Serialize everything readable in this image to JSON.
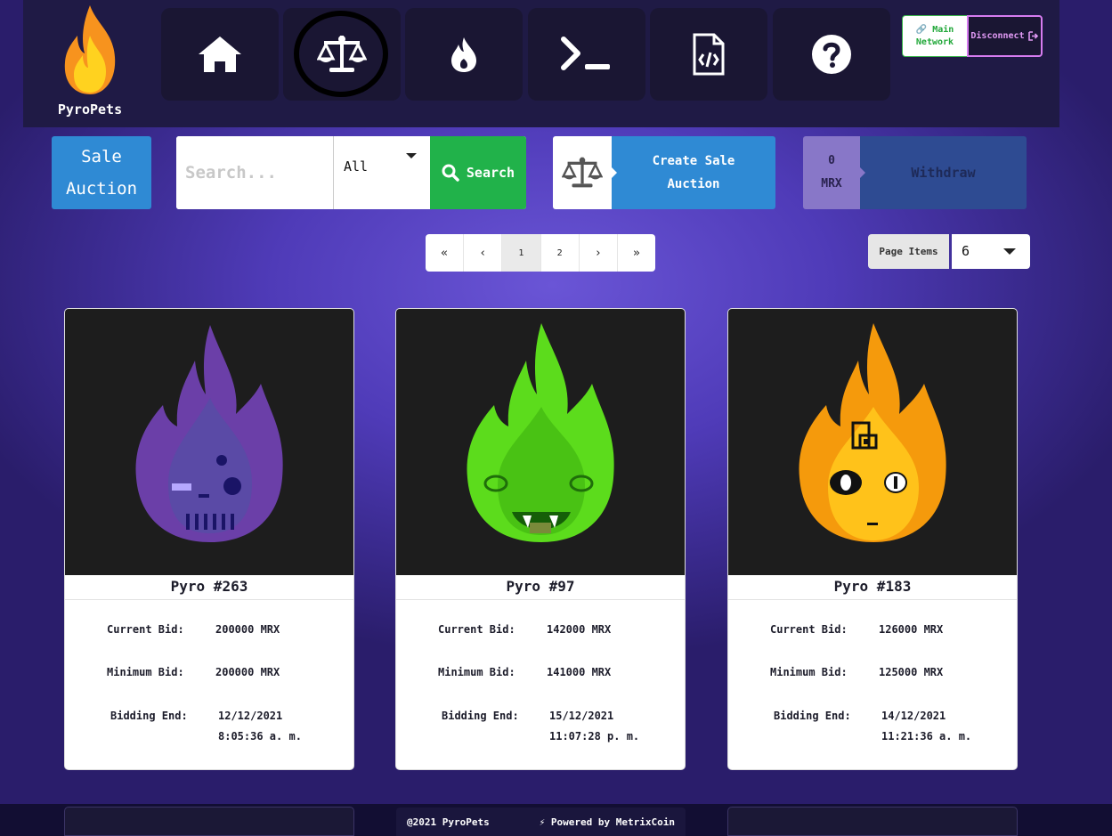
{
  "app": {
    "name": "PyroPets"
  },
  "nav": {
    "items": [
      {
        "id": "home",
        "icon": "home-icon"
      },
      {
        "id": "auction",
        "icon": "scale-icon",
        "active": true
      },
      {
        "id": "fire",
        "icon": "flame-icon"
      },
      {
        "id": "terminal",
        "icon": "terminal-icon"
      },
      {
        "id": "contract",
        "icon": "code-file-icon"
      },
      {
        "id": "help",
        "icon": "question-icon"
      }
    ]
  },
  "network": {
    "line1": "Main",
    "line2": "Network"
  },
  "disconnect_label": "Disconnect",
  "toolbar": {
    "sale_auction_line1": "Sale",
    "sale_auction_line2": "Auction",
    "search_placeholder": "Search...",
    "filter_value": "All",
    "search_label": "Search",
    "create_line1": "Create Sale",
    "create_line2": "Auction",
    "balance_value": "0",
    "balance_unit": "MRX",
    "withdraw_label": "Withdraw"
  },
  "pagination": {
    "first": "«",
    "prev": "‹",
    "pages": [
      "1",
      "2"
    ],
    "next": "›",
    "last": "»",
    "current_page": 1
  },
  "page_items": {
    "label": "Page Items",
    "value": "6"
  },
  "labels": {
    "current_bid": "Current Bid:",
    "minimum_bid": "Minimum Bid:",
    "bidding_end": "Bidding End:"
  },
  "cards": [
    {
      "name": "Pyro #263",
      "current_bid": "200000 MRX",
      "minimum_bid": "200000 MRX",
      "end_date": "12/12/2021",
      "end_time": "8:05:36 a. m."
    },
    {
      "name": "Pyro #97",
      "current_bid": "142000 MRX",
      "minimum_bid": "141000 MRX",
      "end_date": "15/12/2021",
      "end_time": "11:07:28 p. m."
    },
    {
      "name": "Pyro #183",
      "current_bid": "126000 MRX",
      "minimum_bid": "125000 MRX",
      "end_date": "14/12/2021",
      "end_time": "11:21:36 a. m."
    }
  ],
  "footer": {
    "copyright": "@2021 PyroPets",
    "powered": "Powered by MetrixCoin"
  },
  "colors": {
    "accent_blue": "#2f8ad4",
    "search_green": "#21b24a",
    "nav_bg": "#1f1a45"
  }
}
